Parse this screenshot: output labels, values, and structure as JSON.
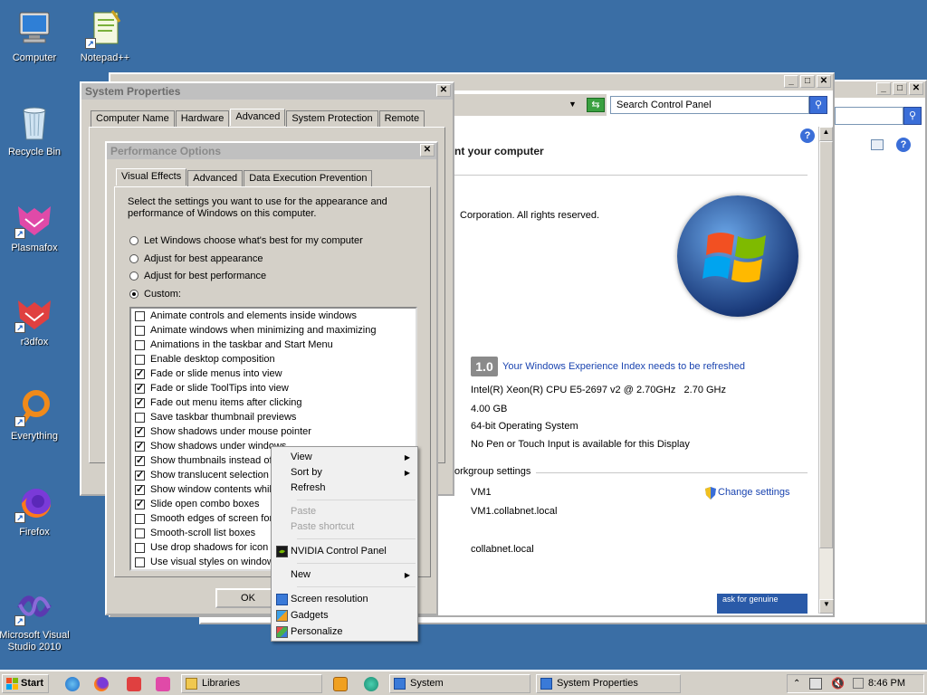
{
  "desktop": {
    "icons": [
      {
        "label": "Computer"
      },
      {
        "label": "Notepad++"
      },
      {
        "label": "Recycle Bin"
      },
      {
        "label": "Plasmafox"
      },
      {
        "label": "r3dfox"
      },
      {
        "label": "Everything"
      },
      {
        "label": "Firefox"
      },
      {
        "label": "Microsoft Visual Studio 2010"
      }
    ]
  },
  "control_panel": {
    "search_placeholder": "Search Control Panel",
    "heading": "nt your computer",
    "copyright": "Corporation.  All rights reserved.",
    "wei_score": "1.0",
    "wei_link": "Your Windows Experience Index needs to be refreshed",
    "processor": "Intel(R) Xeon(R) CPU E5-2697 v2 @ 2.70GHz   2.70 GHz",
    "memory": "4.00 GB",
    "system_type": "64-bit Operating System",
    "pen_touch": "No Pen or Touch Input is available for this Display",
    "workgroup_heading": "orkgroup settings",
    "computer_name": "VM1",
    "full_name": "VM1.collabnet.local",
    "domain": "collabnet.local",
    "change_settings": "Change settings",
    "genuine": "ask for genuine"
  },
  "system_properties": {
    "title": "System Properties",
    "tabs": [
      "Computer Name",
      "Hardware",
      "Advanced",
      "System Protection",
      "Remote"
    ],
    "selected_tab": "Advanced"
  },
  "performance_options": {
    "title": "Performance Options",
    "tabs": [
      "Visual Effects",
      "Advanced",
      "Data Execution Prevention"
    ],
    "intro": "Select the settings you want to use for the appearance and performance of Windows on this computer.",
    "radios": [
      {
        "label": "Let Windows choose what's best for my computer",
        "selected": false
      },
      {
        "label": "Adjust for best appearance",
        "selected": false
      },
      {
        "label": "Adjust for best performance",
        "selected": false
      },
      {
        "label": "Custom:",
        "selected": true
      }
    ],
    "options": [
      {
        "label": "Animate controls and elements inside windows",
        "checked": false
      },
      {
        "label": "Animate windows when minimizing and maximizing",
        "checked": false
      },
      {
        "label": "Animations in the taskbar and Start Menu",
        "checked": false
      },
      {
        "label": "Enable desktop composition",
        "checked": false
      },
      {
        "label": "Fade or slide menus into view",
        "checked": true
      },
      {
        "label": "Fade or slide ToolTips into view",
        "checked": true
      },
      {
        "label": "Fade out menu items after clicking",
        "checked": true
      },
      {
        "label": "Save taskbar thumbnail previews",
        "checked": false
      },
      {
        "label": "Show shadows under mouse pointer",
        "checked": true
      },
      {
        "label": "Show shadows under windows",
        "checked": true
      },
      {
        "label": "Show thumbnails instead of",
        "checked": true
      },
      {
        "label": "Show translucent selection",
        "checked": true
      },
      {
        "label": "Show window contents whil",
        "checked": true
      },
      {
        "label": "Slide open combo boxes",
        "checked": true
      },
      {
        "label": "Smooth edges of screen for",
        "checked": false
      },
      {
        "label": "Smooth-scroll list boxes",
        "checked": false
      },
      {
        "label": "Use drop shadows for icon l",
        "checked": false
      },
      {
        "label": "Use visual styles on window",
        "checked": false
      }
    ],
    "ok_label": "OK"
  },
  "context_menu": {
    "view": "View",
    "sort_by": "Sort by",
    "refresh": "Refresh",
    "paste": "Paste",
    "paste_shortcut": "Paste shortcut",
    "nvidia": "NVIDIA Control Panel",
    "new": "New",
    "screen_resolution": "Screen resolution",
    "gadgets": "Gadgets",
    "personalize": "Personalize"
  },
  "taskbar": {
    "start": "Start",
    "items": [
      "Libraries",
      "System",
      "System Properties"
    ],
    "clock": "8:46 PM"
  }
}
